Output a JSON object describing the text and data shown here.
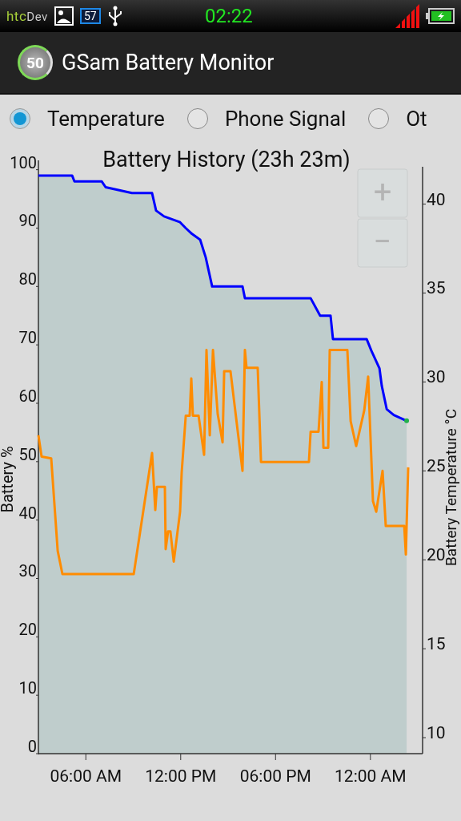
{
  "status_bar": {
    "logo_prefix": "htc",
    "logo_suffix": "Dev",
    "notification_count": "57",
    "time": "02:22"
  },
  "action_bar": {
    "app_badge": "50",
    "title": "GSam Battery Monitor"
  },
  "options": [
    {
      "label": "Temperature",
      "selected": true
    },
    {
      "label": "Phone Signal",
      "selected": false
    },
    {
      "label": "Ot",
      "selected": false
    }
  ],
  "chart": {
    "zoom_controls": [
      "+",
      "−"
    ],
    "chart_data": {
      "type": "line",
      "title": "Battery History (23h 23m)",
      "ylabel": "Battery %",
      "y2label": "Battery Temperature °C",
      "ylim": [
        0,
        100.5
      ],
      "yticks": [
        0,
        10,
        20,
        30,
        40,
        50,
        60,
        70,
        80,
        90,
        100
      ],
      "y2lim": [
        9.1,
        42.1
      ],
      "y2ticks": [
        10,
        15,
        20,
        25,
        30,
        35,
        40
      ],
      "xlim": [
        3,
        27.3
      ],
      "xticks": [
        {
          "value": 6,
          "label": "06:00 AM"
        },
        {
          "value": 12,
          "label": "12:00 PM"
        },
        {
          "value": 18,
          "label": "06:00 PM"
        },
        {
          "value": 24,
          "label": "12:00 AM"
        }
      ],
      "series": [
        {
          "color": "#0000ff",
          "x": [
            3.0,
            5.13,
            5.28,
            7.0,
            7.25,
            8.92,
            10.19,
            10.44,
            10.95,
            11.96,
            12.32,
            12.72,
            13.23,
            13.58,
            13.99,
            15.91,
            16.06,
            20.22,
            20.82,
            21.48,
            21.63,
            23.76,
            24.06,
            24.57,
            24.72,
            25.03,
            25.48,
            26.29
          ],
          "values": [
            99,
            99,
            98,
            98,
            97,
            96,
            96,
            93,
            92,
            91,
            90,
            89,
            88,
            85,
            80,
            80,
            78,
            78,
            75,
            75,
            71,
            71,
            69,
            66,
            63,
            59,
            58,
            57
          ]
        },
        {
          "color": "#ff8c00",
          "axis": "y2",
          "x": [
            3.0,
            3.2,
            3.81,
            4.22,
            4.52,
            9.03,
            10.19,
            10.39,
            10.49,
            11.0,
            11.05,
            11.2,
            11.35,
            11.56,
            11.96,
            12.06,
            12.32,
            12.57,
            12.67,
            12.77,
            13.13,
            13.48,
            13.63,
            13.84,
            14.04,
            14.34,
            14.65,
            14.75,
            15.15,
            15.91,
            16.06,
            16.16,
            16.87,
            17.08,
            20.11,
            20.22,
            20.72,
            20.92,
            21.03,
            21.33,
            21.43,
            22.54,
            22.75,
            23.1,
            23.61,
            23.86,
            24.16,
            24.37,
            24.77,
            24.97,
            25.38,
            26.14,
            26.24,
            26.39
          ],
          "values": [
            27.0,
            25.8,
            25.7,
            20.5,
            19.2,
            19.2,
            26.0,
            22.8,
            24.1,
            24.1,
            20.6,
            21.6,
            21.6,
            19.9,
            22.7,
            24.9,
            28.1,
            28.1,
            30.2,
            28.1,
            28.1,
            25.9,
            31.8,
            27.0,
            31.8,
            28.2,
            26.6,
            30.6,
            30.6,
            25.0,
            31.8,
            30.8,
            30.8,
            25.5,
            25.5,
            27.2,
            27.2,
            30.0,
            26.3,
            26.3,
            31.8,
            31.8,
            27.8,
            26.4,
            28.4,
            30.3,
            23.3,
            22.7,
            25.0,
            21.9,
            21.9,
            21.9,
            20.3,
            25.2
          ]
        }
      ]
    }
  }
}
